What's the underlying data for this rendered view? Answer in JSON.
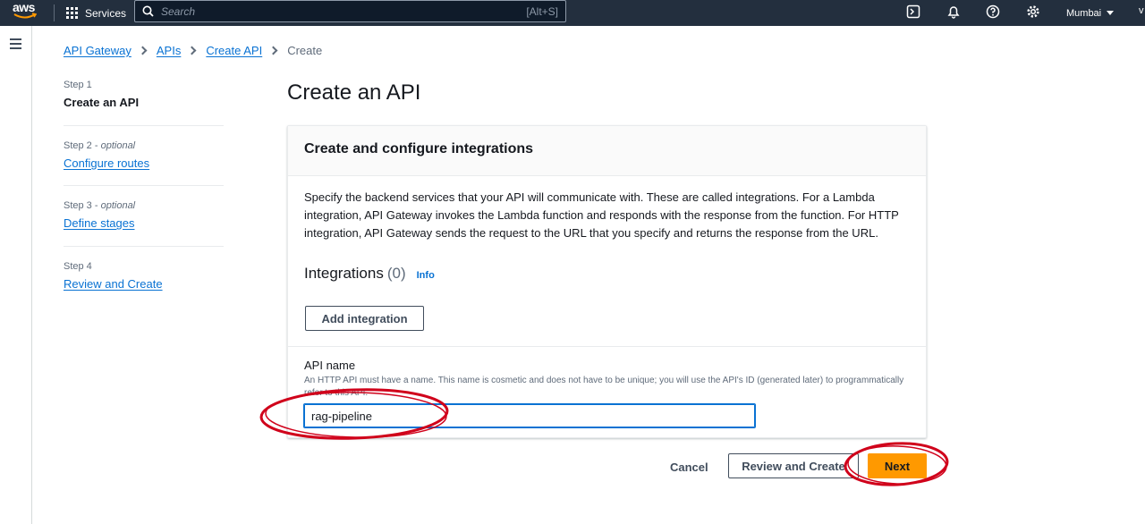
{
  "nav": {
    "logo": "aws",
    "services_label": "Services",
    "search_placeholder": "Search",
    "search_shortcut": "[Alt+S]",
    "region_label": "Mumbai",
    "user_initial": "v",
    "icons": [
      "cloudshell-icon",
      "bell-icon",
      "help-icon",
      "settings-icon"
    ]
  },
  "breadcrumb": {
    "items": [
      "API Gateway",
      "APIs",
      "Create API"
    ],
    "current": "Create"
  },
  "steps": [
    {
      "number": "Step 1",
      "optional": "",
      "title": "Create an API",
      "current": true
    },
    {
      "number": "Step 2",
      "optional": "optional",
      "title": "Configure routes",
      "current": false
    },
    {
      "number": "Step 3",
      "optional": "optional",
      "title": "Define stages",
      "current": false
    },
    {
      "number": "Step 4",
      "optional": "",
      "title": "Review and Create",
      "current": false
    }
  ],
  "page_title": "Create an API",
  "card": {
    "title": "Create and configure integrations",
    "description": "Specify the backend services that your API will communicate with. These are called integrations. For a Lambda integration, API Gateway invokes the Lambda function and responds with the response from the function. For HTTP integration, API Gateway sends the request to the URL that you specify and returns the response from the URL.",
    "integrations_label": "Integrations",
    "integrations_count": "(0)",
    "info_label": "Info",
    "add_integration_label": "Add integration",
    "api_name_label": "API name",
    "api_name_hint": "An HTTP API must have a name. This name is cosmetic and does not have to be unique; you will use the API's ID (generated later) to programmatically refer to this API.",
    "api_name_value": "rag-pipeline"
  },
  "footer": {
    "cancel_label": "Cancel",
    "review_label": "Review and Create",
    "next_label": "Next"
  },
  "colors": {
    "nav_bg": "#232f3e",
    "link": "#0972d3",
    "primary_button": "#ff9900",
    "annotation": "#d0021b"
  }
}
